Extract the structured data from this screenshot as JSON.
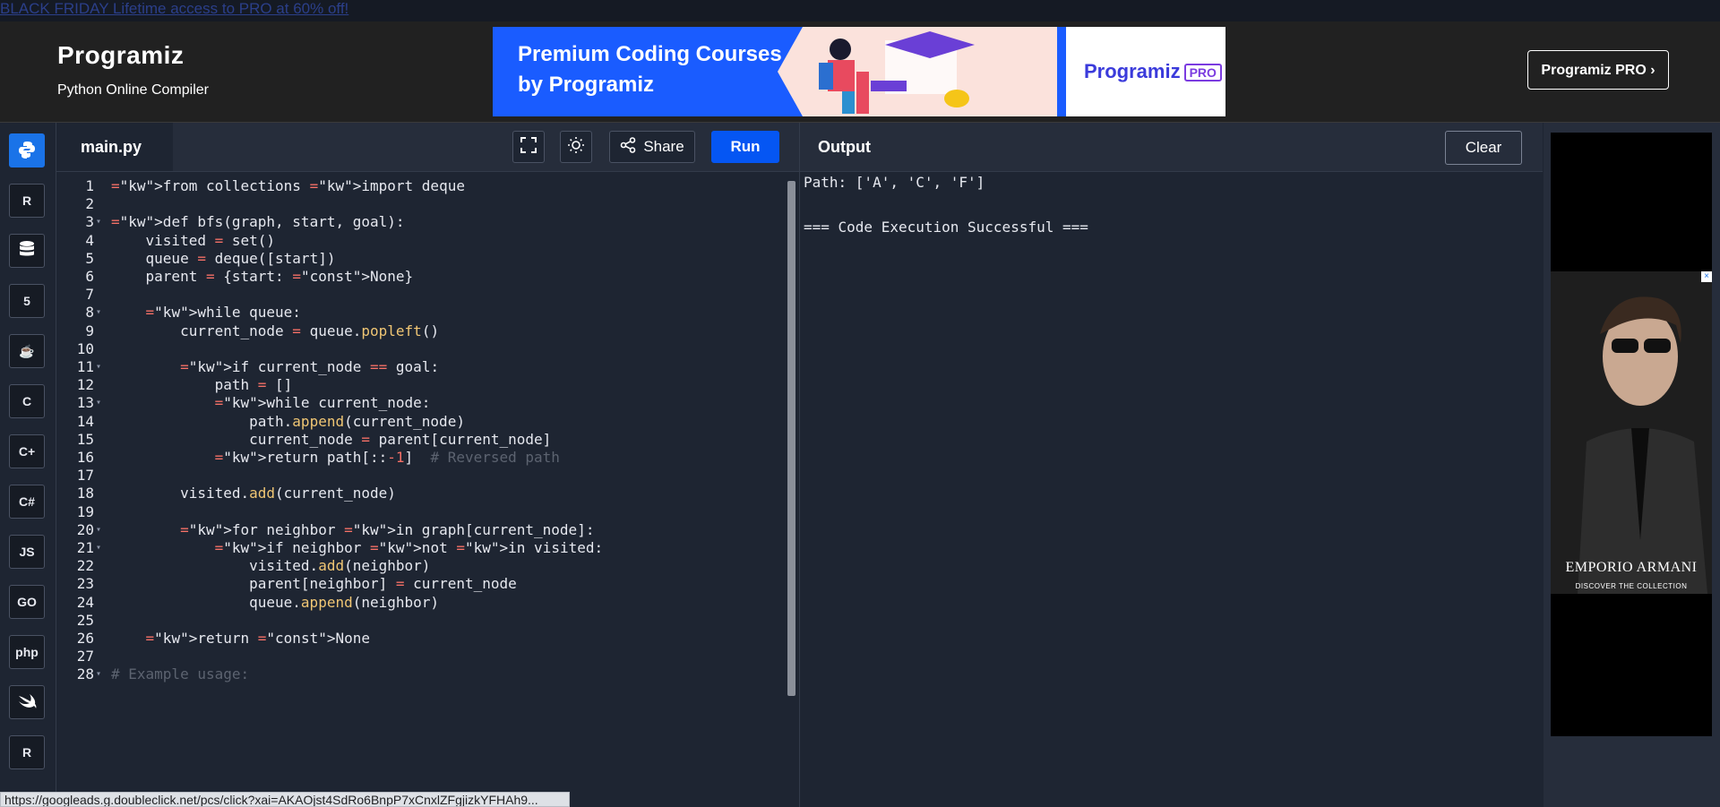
{
  "promo": {
    "text": "BLACK FRIDAY Lifetime access to PRO at 60% off!"
  },
  "header": {
    "logo": "Programiz",
    "subtitle": "Python Online Compiler",
    "pro_button": "Programiz PRO ›",
    "banner": {
      "headline": "Premium Coding Courses by Programiz",
      "logo": "Programiz",
      "badge": "PRO"
    }
  },
  "sidebar": {
    "languages": [
      {
        "name": "python-icon",
        "label": ""
      },
      {
        "name": "r-icon",
        "label": "R"
      },
      {
        "name": "sql-icon",
        "label": ""
      },
      {
        "name": "html-icon",
        "label": "5"
      },
      {
        "name": "java-icon",
        "label": "☕"
      },
      {
        "name": "c-icon",
        "label": "C"
      },
      {
        "name": "cpp-icon",
        "label": "C+"
      },
      {
        "name": "csharp-icon",
        "label": "C#"
      },
      {
        "name": "js-icon",
        "label": "JS"
      },
      {
        "name": "go-icon",
        "label": "GO"
      },
      {
        "name": "php-icon",
        "label": "php"
      },
      {
        "name": "swift-icon",
        "label": ""
      },
      {
        "name": "rust-icon",
        "label": "R"
      }
    ]
  },
  "editor": {
    "filename": "main.py",
    "share_label": "Share",
    "run_label": "Run",
    "lines": [
      "from collections import deque",
      "",
      "def bfs(graph, start, goal):",
      "    visited = set()",
      "    queue = deque([start])",
      "    parent = {start: None}",
      "",
      "    while queue:",
      "        current_node = queue.popleft()",
      "",
      "        if current_node == goal:",
      "            path = []",
      "            while current_node:",
      "                path.append(current_node)",
      "                current_node = parent[current_node]",
      "            return path[::-1]  # Reversed path",
      "",
      "        visited.add(current_node)",
      "",
      "        for neighbor in graph[current_node]:",
      "            if neighbor not in visited:",
      "                visited.add(neighbor)",
      "                parent[neighbor] = current_node",
      "                queue.append(neighbor)",
      "",
      "    return None",
      "",
      "# Example usage:"
    ],
    "fold_lines": [
      3,
      8,
      11,
      13,
      20,
      21,
      28
    ]
  },
  "output": {
    "title": "Output",
    "clear_label": "Clear",
    "lines": [
      "Path: ['A', 'C', 'F']",
      "",
      "=== Code Execution Successful ==="
    ]
  },
  "ad": {
    "brand": "EMPORIO ARMANI",
    "cta": "DISCOVER THE COLLECTION"
  },
  "status_bar": {
    "url": "https://googleads.g.doubleclick.net/pcs/click?xai=AKAOjst4SdRo6BnpP7xCnxlZFgjizkYFHAh9..."
  }
}
